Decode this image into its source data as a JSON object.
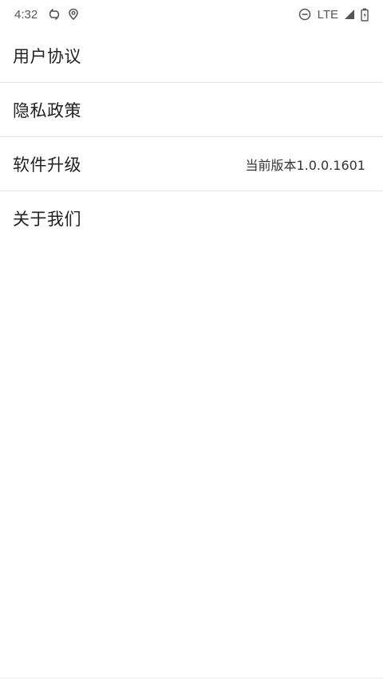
{
  "status_bar": {
    "time": "4:32",
    "left_icons": [
      "sync-icon",
      "location-icon"
    ],
    "network": "LTE",
    "right_icons": [
      "do-not-disturb-icon",
      "signal-icon",
      "battery-icon"
    ]
  },
  "settings": {
    "items": [
      {
        "label": "用户协议",
        "value": ""
      },
      {
        "label": "隐私政策",
        "value": ""
      },
      {
        "label": "软件升级",
        "value": "当前版本1.0.0.1601"
      },
      {
        "label": "关于我们",
        "value": ""
      }
    ]
  },
  "colors": {
    "background": "#ffffff",
    "divider": "#e6e6e6",
    "text_primary": "#222222",
    "status_icon": "#555555"
  }
}
